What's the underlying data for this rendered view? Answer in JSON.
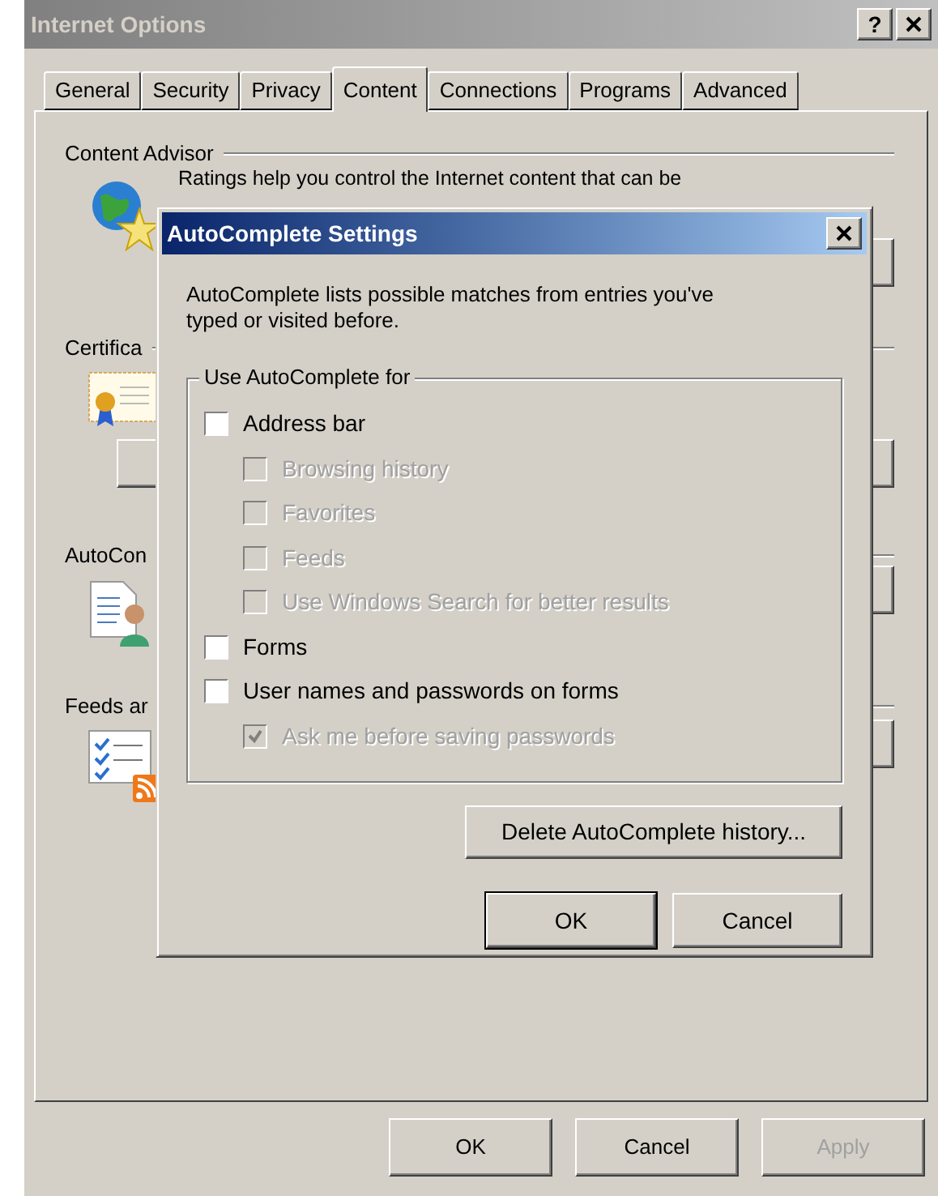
{
  "window": {
    "title": "Internet Options",
    "help_label": "?"
  },
  "tabs": [
    {
      "label": "General",
      "selected": false
    },
    {
      "label": "Security",
      "selected": false
    },
    {
      "label": "Privacy",
      "selected": false
    },
    {
      "label": "Content",
      "selected": true
    },
    {
      "label": "Connections",
      "selected": false
    },
    {
      "label": "Programs",
      "selected": false
    },
    {
      "label": "Advanced",
      "selected": false
    }
  ],
  "sections": [
    {
      "heading": "Content Advisor",
      "text": "Ratings help you control the Internet content that can be",
      "kind": "ratings"
    },
    {
      "heading": "Certifica",
      "kind": "certificates"
    },
    {
      "heading": "AutoCon",
      "kind": "autocomplete"
    },
    {
      "heading": "Feeds ar",
      "kind": "feeds"
    }
  ],
  "buttons": [
    {
      "label": "OK",
      "disabled": false
    },
    {
      "label": "Cancel",
      "disabled": false
    },
    {
      "label": "Apply",
      "disabled": true
    }
  ],
  "dialog": {
    "title": "AutoComplete Settings",
    "description": "AutoComplete lists possible matches from entries you've typed or visited before.",
    "group_label": "Use AutoComplete for",
    "options": [
      {
        "label": "Address bar",
        "checked": false,
        "disabled": false,
        "children": [
          {
            "label": "Browsing history",
            "checked": false,
            "disabled": true
          },
          {
            "label": "Favorites",
            "checked": false,
            "disabled": true
          },
          {
            "label": "Feeds",
            "checked": false,
            "disabled": true
          },
          {
            "label": "Use Windows Search for better results",
            "checked": false,
            "disabled": true
          }
        ]
      },
      {
        "label": "Forms",
        "checked": false,
        "disabled": false
      },
      {
        "label": "User names and passwords on forms",
        "checked": false,
        "disabled": false,
        "children": [
          {
            "label": "Ask me before saving passwords",
            "checked": true,
            "disabled": true
          }
        ]
      }
    ],
    "delete_button": "Delete AutoComplete history...",
    "buttons": [
      {
        "label": "OK",
        "default": true
      },
      {
        "label": "Cancel",
        "default": false
      }
    ]
  }
}
